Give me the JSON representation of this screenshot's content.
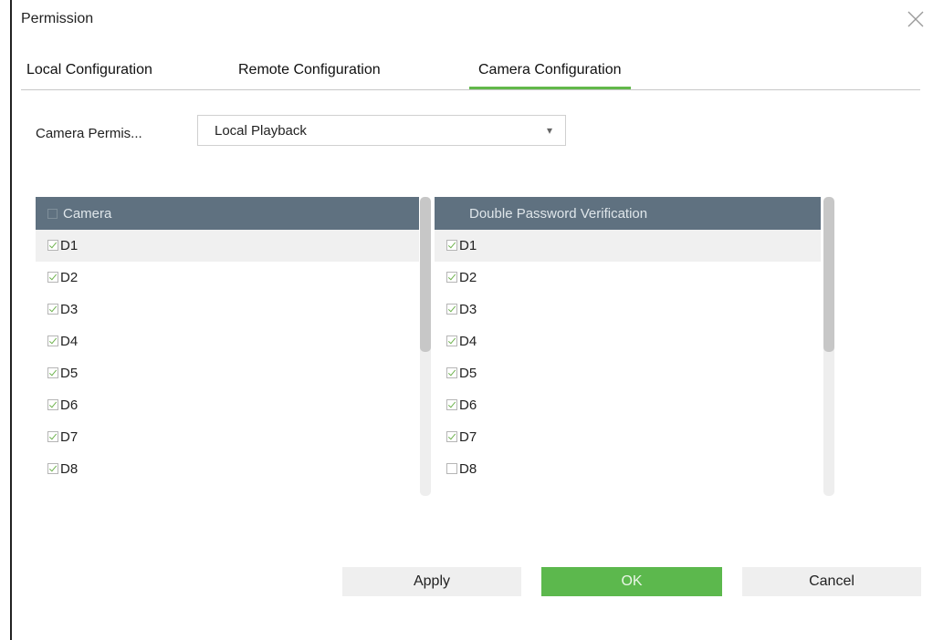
{
  "dialog": {
    "title": "Permission"
  },
  "tabs": [
    {
      "label": "Local Configuration"
    },
    {
      "label": "Remote Configuration"
    },
    {
      "label": "Camera Configuration",
      "active": true
    }
  ],
  "camera_permission": {
    "label": "Camera Permis...",
    "value": "Local Playback"
  },
  "left_list": {
    "header": "Camera",
    "rows": [
      {
        "label": "D1",
        "checked": true
      },
      {
        "label": "D2",
        "checked": true
      },
      {
        "label": "D3",
        "checked": true
      },
      {
        "label": "D4",
        "checked": true
      },
      {
        "label": "D5",
        "checked": true
      },
      {
        "label": "D6",
        "checked": true
      },
      {
        "label": "D7",
        "checked": true
      },
      {
        "label": "D8",
        "checked": true
      }
    ]
  },
  "right_list": {
    "header": "Double Password Verification",
    "rows": [
      {
        "label": "D1",
        "checked": true
      },
      {
        "label": "D2",
        "checked": true
      },
      {
        "label": "D3",
        "checked": true
      },
      {
        "label": "D4",
        "checked": true
      },
      {
        "label": "D5",
        "checked": true
      },
      {
        "label": "D6",
        "checked": true
      },
      {
        "label": "D7",
        "checked": true
      },
      {
        "label": "D8",
        "checked": false
      }
    ]
  },
  "buttons": {
    "apply": "Apply",
    "ok": "OK",
    "cancel": "Cancel"
  },
  "colors": {
    "accent": "#5cb84d",
    "header_bg": "#5f7180"
  }
}
